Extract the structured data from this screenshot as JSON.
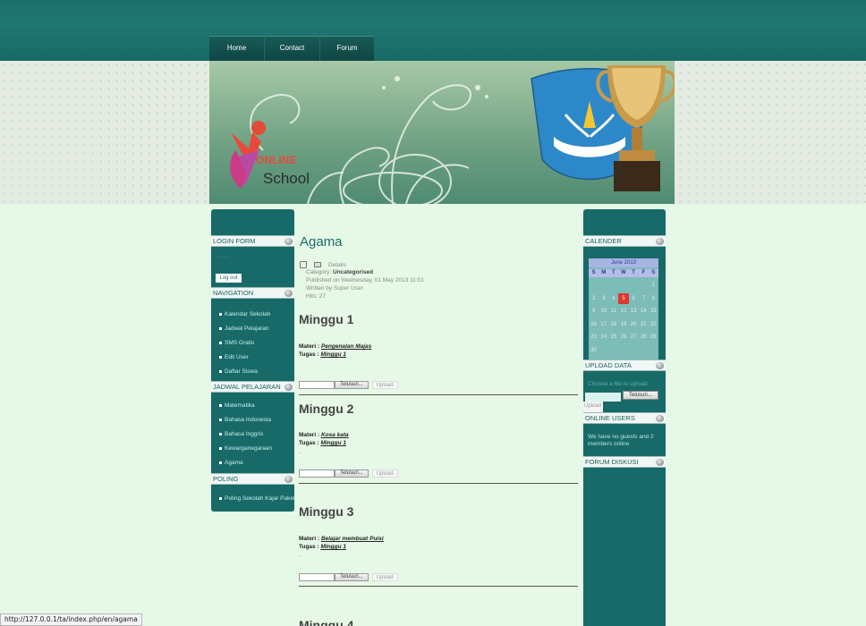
{
  "nav": {
    "tabs": [
      "Home",
      "Contact",
      "Forum"
    ]
  },
  "banner": {
    "logo_online": "ONLINE",
    "logo_school": "School",
    "emblem_text": "TUT WURI HANDAYANI"
  },
  "left_sidebar": {
    "login_title": "LOGIN FORM",
    "logout_label": "Log out",
    "navigation_title": "NAVIGATION",
    "navigation_items": [
      "Kalendar Sekolah",
      "Jadwal Pelajaran",
      "SMS Gratis",
      "Edit User",
      "Daftar Siswa"
    ],
    "jadwal_title": "JADWAL PELAJARAN",
    "jadwal_items": [
      "Matematika",
      "Bahasa Indonesia",
      "Bahasa Inggris",
      "Kewarganegaraan",
      "Agama"
    ],
    "poling_title": "POLING",
    "poling_items": [
      "Poling Sekolah Kajar Paket"
    ]
  },
  "article": {
    "title": "Agama",
    "details_label": "Details",
    "category_label": "Category:",
    "category": "Uncategorised",
    "published": "Published on Wednesday, 01 May 2013 11:01",
    "written_by": "Written by Super User",
    "hits": "Hits: 27",
    "materi_label": "Materi :",
    "tugas_label": "Tugas :",
    "browse_label": "Telusuri...",
    "upload_label": "Upload",
    "weeks": [
      {
        "title": "Minggu 1",
        "materi": "Pengenalan Majas",
        "tugas": "Minggu 1"
      },
      {
        "title": "Minggu 2",
        "materi": "Kosa kata",
        "tugas": "Minggu 1"
      },
      {
        "title": "Minggu 3",
        "materi": "Belajar membuat Puisi",
        "tugas": "Minggu 1"
      },
      {
        "title": "Minggu 4"
      }
    ]
  },
  "right_sidebar": {
    "calendar_title": "CALENDER",
    "calendar_month": "June 2013",
    "weekdays": [
      "S",
      "M",
      "T",
      "W",
      "T",
      "F",
      "S"
    ],
    "calendar_rows": [
      [
        "",
        "",
        "",
        "",
        "",
        "",
        "1"
      ],
      [
        "2",
        "3",
        "4",
        "5",
        "6",
        "7",
        "8"
      ],
      [
        "9",
        "10",
        "11",
        "12",
        "13",
        "14",
        "15"
      ],
      [
        "16",
        "17",
        "18",
        "19",
        "20",
        "21",
        "22"
      ],
      [
        "23",
        "24",
        "25",
        "26",
        "27",
        "28",
        "29"
      ],
      [
        "30",
        "",
        "",
        "",
        "",
        "",
        ""
      ]
    ],
    "today": "5",
    "upload_title": "UPLOAD DATA",
    "upload_hint": "Choose a file to upload:",
    "browse_label": "Telusuri...",
    "upload_label": "Upload",
    "online_title": "ONLINE USERS",
    "online_text": "We have no guests and 2 members online",
    "forum_title": "FORUM DISKUSI"
  },
  "status_bar": {
    "url": "http://127.0.0.1/ta/index.php/en/agama"
  }
}
